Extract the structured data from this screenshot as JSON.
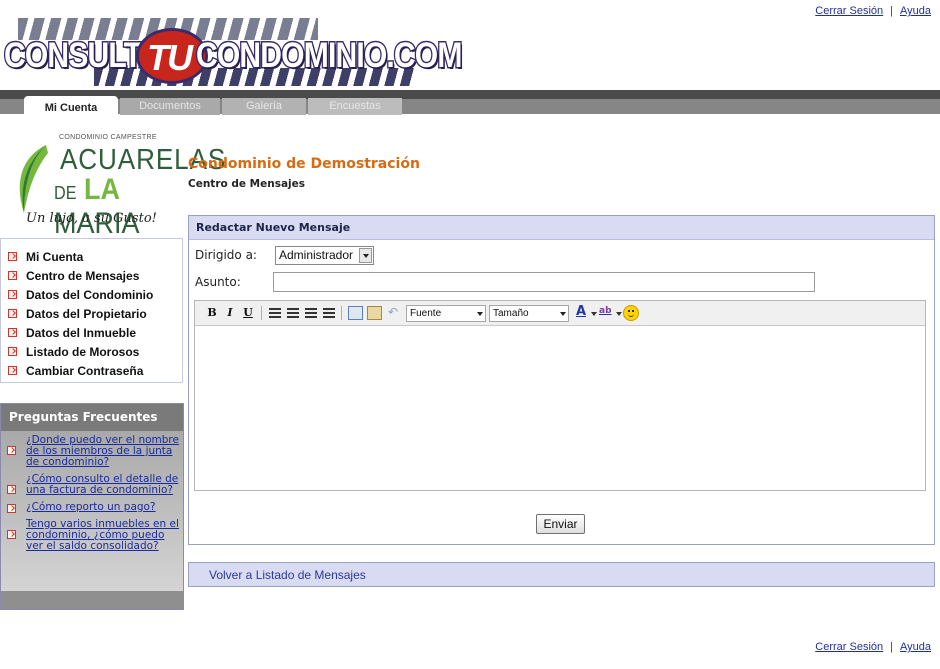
{
  "top_links": {
    "logout": "Cerrar Sesión",
    "separator": "|",
    "help": "Ayuda"
  },
  "logo": {
    "part1": "CONSULTA",
    "part2": "TU",
    "part3": "CONDOMINIO.COM"
  },
  "tabs": [
    {
      "label": "Mi Cuenta",
      "active": true
    },
    {
      "label": "Documentos",
      "active": false
    },
    {
      "label": "Galería",
      "active": false
    },
    {
      "label": "Encuestas",
      "active": false
    }
  ],
  "condo_logo": {
    "small": "CONDOMINIO CAMPESTRE",
    "line1": "ACUARELAS",
    "line2_de": "DE",
    "line2_la": "LA",
    "line2_maria": "MARIA",
    "tagline": "Un lujo, a su Gusto!"
  },
  "left_nav": [
    {
      "label": "Mi Cuenta"
    },
    {
      "label": "Centro de Mensajes"
    },
    {
      "label": "Datos del Condominio"
    },
    {
      "label": "Datos del Propietario"
    },
    {
      "label": "Datos del Inmueble"
    },
    {
      "label": "Listado de Morosos"
    },
    {
      "label": "Cambiar Contraseña"
    }
  ],
  "faq": {
    "title": "Preguntas Frecuentes",
    "items": [
      "¿Donde puedo ver el nombre de los miembros de la junta de condominio?",
      "¿Cómo consulto el detalle de una factura de condominio?",
      "¿Cómo reporto un pago?",
      "Tengo varios inmuebles en el condominio, ¿cómo puedo ver el saldo consolidado?"
    ]
  },
  "header": {
    "title": "Condominio de Demostración",
    "subtitle": "Centro de Mensajes"
  },
  "compose": {
    "heading": "Redactar Nuevo Mensaje",
    "to_label": "Dirigido a:",
    "to_value": "Administrador",
    "subject_label": "Asunto:",
    "subject_value": "",
    "font_dropdown": "Fuente",
    "size_dropdown": "Tamaño",
    "bold": "B",
    "italic": "I",
    "underline": "U",
    "font_color_glyph": "A",
    "highlight_glyph": "ab",
    "send_label": "Enviar"
  },
  "back_link": "Volver a Listado de Mensajes",
  "bottom_links": {
    "logout": "Cerrar Sesión",
    "separator": "|",
    "help": "Ayuda"
  }
}
